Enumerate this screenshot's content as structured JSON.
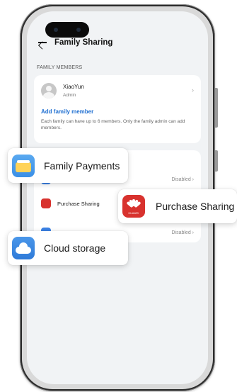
{
  "header": {
    "title": "Family Sharing"
  },
  "members_section": {
    "label": "FAMILY MEMBERS",
    "member": {
      "name": "XiaoYun",
      "role": "Admin"
    },
    "add_label": "Add family member",
    "note": "Each family can have up to 6 members. Only the family admin can add members."
  },
  "features": [
    {
      "label": "Family Payments",
      "status": "Disabled",
      "icon": "wallet-icon"
    },
    {
      "label": "Purchase Sharing",
      "status": "",
      "icon": "huawei-icon"
    },
    {
      "label": "Cloud storage",
      "status": "Disabled",
      "icon": "cloud-icon"
    }
  ],
  "callouts": {
    "payments": "Family Payments",
    "sharing": "Purchase Sharing",
    "cloud": "Cloud storage",
    "brand_text": "HUAWEI"
  },
  "colors": {
    "accent": "#1f6fd1",
    "huawei_red": "#d8322e",
    "cloud_blue": "#3b82e6"
  }
}
